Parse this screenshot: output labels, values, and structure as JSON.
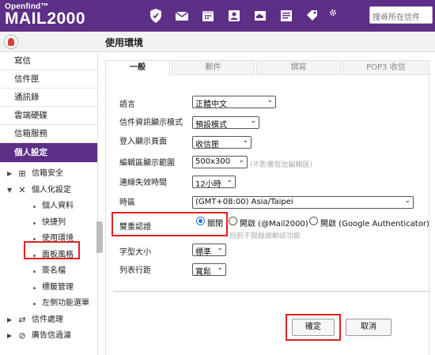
{
  "header": {
    "brand_top": "Openfind™",
    "brand_main": "MAIL2000",
    "search_placeholder": "搜尋所在信件",
    "icons": [
      "shield-icon",
      "mail-icon",
      "calendar-icon",
      "contacts-icon",
      "cloud-drive-icon",
      "notes-icon",
      "tag-icon",
      "settings-icon"
    ]
  },
  "page": {
    "title": "使用環境"
  },
  "sidebar": {
    "items": [
      {
        "label": "寫信"
      },
      {
        "label": "信件匣"
      },
      {
        "label": "通訊錄"
      },
      {
        "label": "雲端硬碟"
      },
      {
        "label": "信箱服務"
      },
      {
        "label": "個人設定"
      }
    ],
    "tree": [
      {
        "label": "信箱安全",
        "icon": "mailbox-security-icon",
        "level": 1
      },
      {
        "label": "個人化設定",
        "icon": "tools-icon",
        "level": 1
      },
      {
        "label": "個人資料",
        "level": 2
      },
      {
        "label": "快捷列",
        "level": 2
      },
      {
        "label": "使用環境",
        "level": 2
      },
      {
        "label": "面板風格",
        "level": 2
      },
      {
        "label": "簽名檔",
        "level": 2
      },
      {
        "label": "標籤管理",
        "level": 2
      },
      {
        "label": "左側功能選單",
        "level": 2
      },
      {
        "label": "信件處理",
        "icon": "mail-process-icon",
        "level": 1
      },
      {
        "label": "廣告信過濾",
        "icon": "block-icon",
        "level": 1
      }
    ]
  },
  "tabs": [
    {
      "label": "一般"
    },
    {
      "label": "郵件"
    },
    {
      "label": "撰寫"
    },
    {
      "label": "POP3 收信"
    }
  ],
  "form": {
    "language": {
      "label": "語言",
      "value": "正體中文"
    },
    "display_mode": {
      "label": "信件資訊顯示模式",
      "value": "預設模式"
    },
    "login_page": {
      "label": "登入顯示頁面",
      "value": "收信匣"
    },
    "editor_size": {
      "label": "編輯區顯示範圍",
      "value": "500x300",
      "note": "(不影響寫信編輯區)"
    },
    "timeout": {
      "label": "連線失效時間",
      "value": "12小時"
    },
    "timezone": {
      "label": "時區",
      "value": "(GMT+08:00) Asia/Taipei"
    },
    "two_factor": {
      "label": "雙重認證",
      "options": [
        "關閉",
        "開啟 (@Mail2000)",
        "開啟 (Google Authenticator)"
      ],
      "selected": "關閉",
      "note": "目前不開啟啟動該功能"
    },
    "font_size": {
      "label": "字型大小",
      "value": "標準"
    },
    "line_spacing": {
      "label": "列表行距",
      "value": "寬鬆"
    }
  },
  "buttons": {
    "ok": "確定",
    "cancel": "取消"
  },
  "colors": {
    "brand": "#5d2f86",
    "highlight": "#e02020"
  }
}
